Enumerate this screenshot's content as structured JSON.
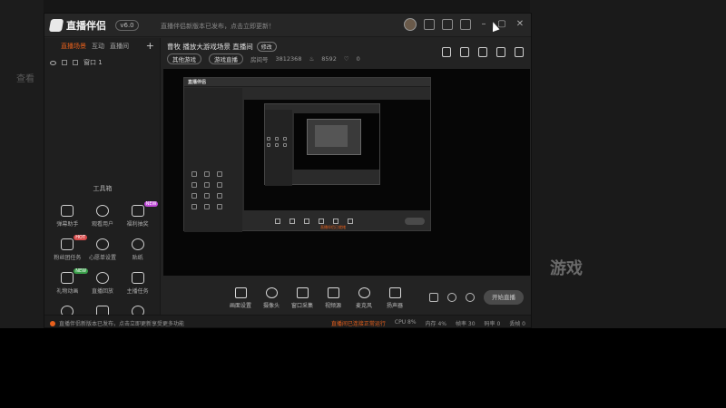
{
  "app": {
    "name": "直播伴侣",
    "version": "v6.0",
    "notice": "直播伴侣新版本已发布，点击立即更新！"
  },
  "titlebar_icons": [
    "avatar",
    "live-icon",
    "lock-icon",
    "shirt-icon",
    "minimize-icon",
    "maximize-icon",
    "close-icon"
  ],
  "sidebar": {
    "tabs": [
      "直播场景",
      "互动",
      "直播间"
    ],
    "add_label": "+",
    "scene": "窗口 1",
    "tools_title": "工具箱",
    "tools": [
      {
        "label": "弹幕助手",
        "icon": "comment-icon"
      },
      {
        "label": "观看用户",
        "icon": "user-icon"
      },
      {
        "label": "福利抽奖",
        "icon": "gift-icon",
        "tag": "NEW",
        "tag_color": "#c04bd8"
      },
      {
        "label": "粉丝团任务",
        "icon": "shield-icon",
        "tag": "HOT",
        "tag_color": "#d84b4b"
      },
      {
        "label": "心愿单设置",
        "icon": "cloud-icon"
      },
      {
        "label": "贴纸",
        "icon": "sticker-icon"
      },
      {
        "label": "礼物动画",
        "icon": "gift-box-icon",
        "tag": "NEW",
        "tag_color": "#3aa04a"
      },
      {
        "label": "直播回放",
        "icon": "clip-icon"
      },
      {
        "label": "主播任务",
        "icon": "task-icon"
      },
      {
        "label": "",
        "icon": "scale-icon"
      },
      {
        "label": "",
        "icon": "person-icon"
      },
      {
        "label": "",
        "icon": "cloud2-icon"
      }
    ]
  },
  "room": {
    "title": "曹牧 播放大游戏场景 直播间",
    "edit_label": "修改",
    "category_label": "其他游戏",
    "category_pill": "游戏直播",
    "id_label": "房间号",
    "id_value": "3812368",
    "fans": "8592",
    "likes": "0"
  },
  "room_tools": [
    "fullscreen-icon",
    "lock-icon",
    "share-screen-icon",
    "bell-icon",
    "share-icon"
  ],
  "inner": {
    "logo": "直播伴侣",
    "status": "直播伴侣已就绪"
  },
  "bottombar": {
    "items": [
      {
        "label": "画面设置",
        "icon": "monitor-icon"
      },
      {
        "label": "摄像头",
        "icon": "camera-icon"
      },
      {
        "label": "窗口采集",
        "icon": "window-icon"
      },
      {
        "label": "视频源",
        "icon": "video-icon"
      },
      {
        "label": "麦克风",
        "icon": "mic-icon"
      },
      {
        "label": "扬声器",
        "icon": "speaker-icon"
      }
    ],
    "start_label": "开始直播"
  },
  "statusbar": {
    "left": "直播伴侣新版本已发布，点击立即更新享受更多功能",
    "right_orange": "直播间已连接正常运行",
    "stats": [
      "CPU 8%",
      "内存 4%",
      "帧率 30",
      "码率 0",
      "丢帧 0"
    ]
  },
  "background": {
    "texts": [
      "查看",
      "游戏"
    ]
  }
}
